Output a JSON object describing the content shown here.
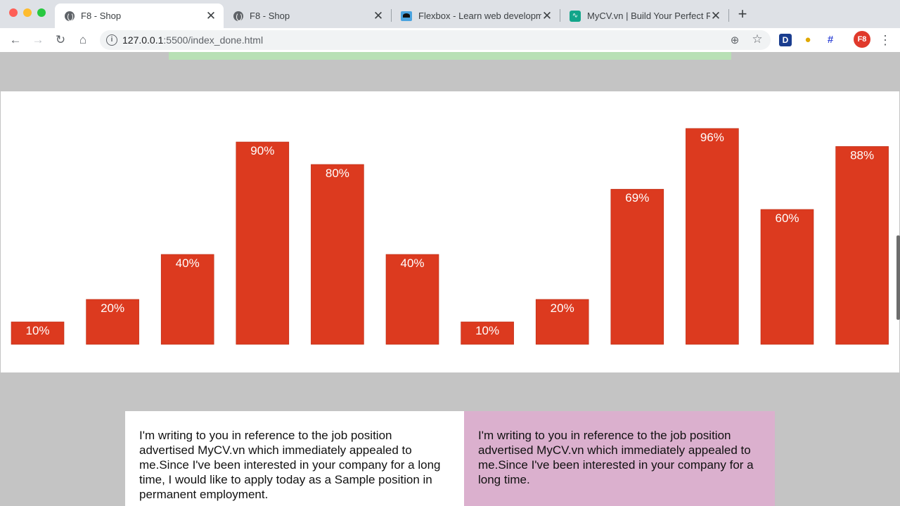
{
  "browser": {
    "tabs": [
      {
        "title": "F8 - Shop",
        "active": true,
        "favicon": "globe-icon"
      },
      {
        "title": "F8 - Shop",
        "active": false,
        "favicon": "globe-icon"
      },
      {
        "title": "Flexbox - Learn web developm",
        "active": false,
        "favicon": "mdn-icon"
      },
      {
        "title": "MyCV.vn | Build Your Perfect R",
        "active": false,
        "favicon": "mycv-icon"
      }
    ],
    "url_host": "127.0.0.1",
    "url_rest": ":5500/index_done.html",
    "profile_label": "F8",
    "extension_d_label": "D"
  },
  "chart_data": {
    "type": "bar",
    "categories": [
      "",
      "",
      "",
      "",
      "",
      "",
      "",
      "",
      "",
      "",
      "",
      ""
    ],
    "values": [
      10,
      20,
      40,
      90,
      80,
      40,
      10,
      20,
      69,
      96,
      60,
      88
    ],
    "labels": [
      "10%",
      "20%",
      "40%",
      "90%",
      "80%",
      "40%",
      "10%",
      "20%",
      "69%",
      "96%",
      "60%",
      "88%"
    ],
    "ylim": [
      0,
      100
    ],
    "bar_color": "#dc3a1f",
    "label_color": "#ffffff"
  },
  "cards": {
    "left_text": "I'm writing to you in reference to the job position advertised MyCV.vn which immediately appealed to me.Since I've been interested in your company for a long time, I would like to apply today as a Sample position in permanent employment.",
    "right_text": "I'm writing to you in reference to the job position advertised MyCV.vn which immediately appealed to me.Since I've been interested in your company for a long time."
  },
  "colors": {
    "page_bg": "#c4c4c4",
    "card_pink": "#dbb0ce",
    "green_strip": "#b8e0b5"
  }
}
